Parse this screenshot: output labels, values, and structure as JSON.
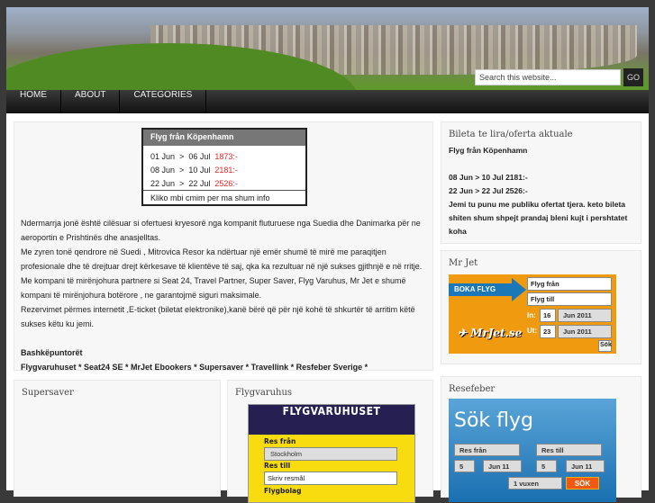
{
  "header": {
    "search_placeholder": "Search this website...",
    "go_label": "GO"
  },
  "nav": [
    {
      "label": "HOME"
    },
    {
      "label": "ABOUT"
    },
    {
      "label": "CATEGORIES"
    }
  ],
  "offer_table": {
    "title": "Flyg från Köpenhamn",
    "rows": [
      {
        "from": "01  Jun",
        "sep": ">",
        "to": "06 Jul",
        "price": "1873:-"
      },
      {
        "from": "08  Jun",
        "sep": ">",
        "to": "10 Jul",
        "price": "2181:-"
      },
      {
        "from": "22  Jun",
        "sep": ">",
        "to": "22 Jul",
        "price": "2526:-"
      }
    ],
    "footer": "Kliko mbi cmim per ma shum info"
  },
  "main_text": {
    "paragraphs": [
      "Ndermarrja jonë është cilësuar si ofertuesi kryesorë nga kompanit fluturuese nga Suedia dhe Danimarka për ne aeroportin e Prishtinës dhe anasjelltas.",
      "Me zyren tonë qendrore në Suedi , Mitrovica Resor ka ndërtuar një emër shumë të mirë me paraqitjen profesionale dhe të drejtuar drejt kërkesave të klientëve të saj, qka ka rezultuar në një sukses gjithnjë e në rritje.",
      "Me kompani të mirënjohura partnere si Seat 24, Travel Partner, Super Saver, Flyg Varuhus, Mr Jet e shumë kompani të mirënjohura botërore , ne garantojmë siguri maksimale.",
      "Rezervimet përmes internetit ,E-ticket (biletat elektronike),kanë bërë që për një kohë të shkurtër të arritim këtë sukses këtu ku jemi."
    ],
    "partners_title": "Bashkëpuntorët",
    "partners": "Flygvaruhuset * Seat24 SE * MrJet Ebookers * Supersaver * Travellink  * Resfeber Sverige  *"
  },
  "sidebar": {
    "offers": {
      "title": "Bileta te lira/oferta aktuale",
      "lines": [
        "Flyg från Köpenhamn",
        "",
        "08 Jun > 10 Jul 2181:-",
        "22 Jun > 22 Jul  2526:-",
        "Jemi tu punu me publiku ofertat tjera. keto bileta shiten shum shpejt prandaj bleni kujt i pershtatet koha"
      ]
    },
    "mrjet": {
      "title": "Mr Jet",
      "boka": "BOKA FLYG",
      "from": "Flyg från",
      "to": "Flyg till",
      "in_label": "In:",
      "in_day": "16",
      "in_month": "Jun 2011",
      "out_label": "Ut:",
      "out_day": "23",
      "out_month": "Jun 2011",
      "search": "Sök",
      "logo": "MrJet.se"
    },
    "resefeber": {
      "title": "Resefeber",
      "heading": "Sök flyg",
      "from": "Res från",
      "to": "Res till",
      "day1": "5",
      "month1": "Jun 11",
      "day2": "5",
      "month2": "Jun 11",
      "pax": "1 vuxen",
      "search": "SÖK"
    }
  },
  "supersaver": {
    "title": "Supersaver"
  },
  "flygvaruhus": {
    "title": "Flygvaruhus",
    "brand": "FLYGVARUHUSET",
    "from_label": "Res från",
    "from_value": "Stockholm",
    "to_label": "Res till",
    "to_placeholder": "Skriv resmål",
    "airline_label": "Flygbolag"
  }
}
